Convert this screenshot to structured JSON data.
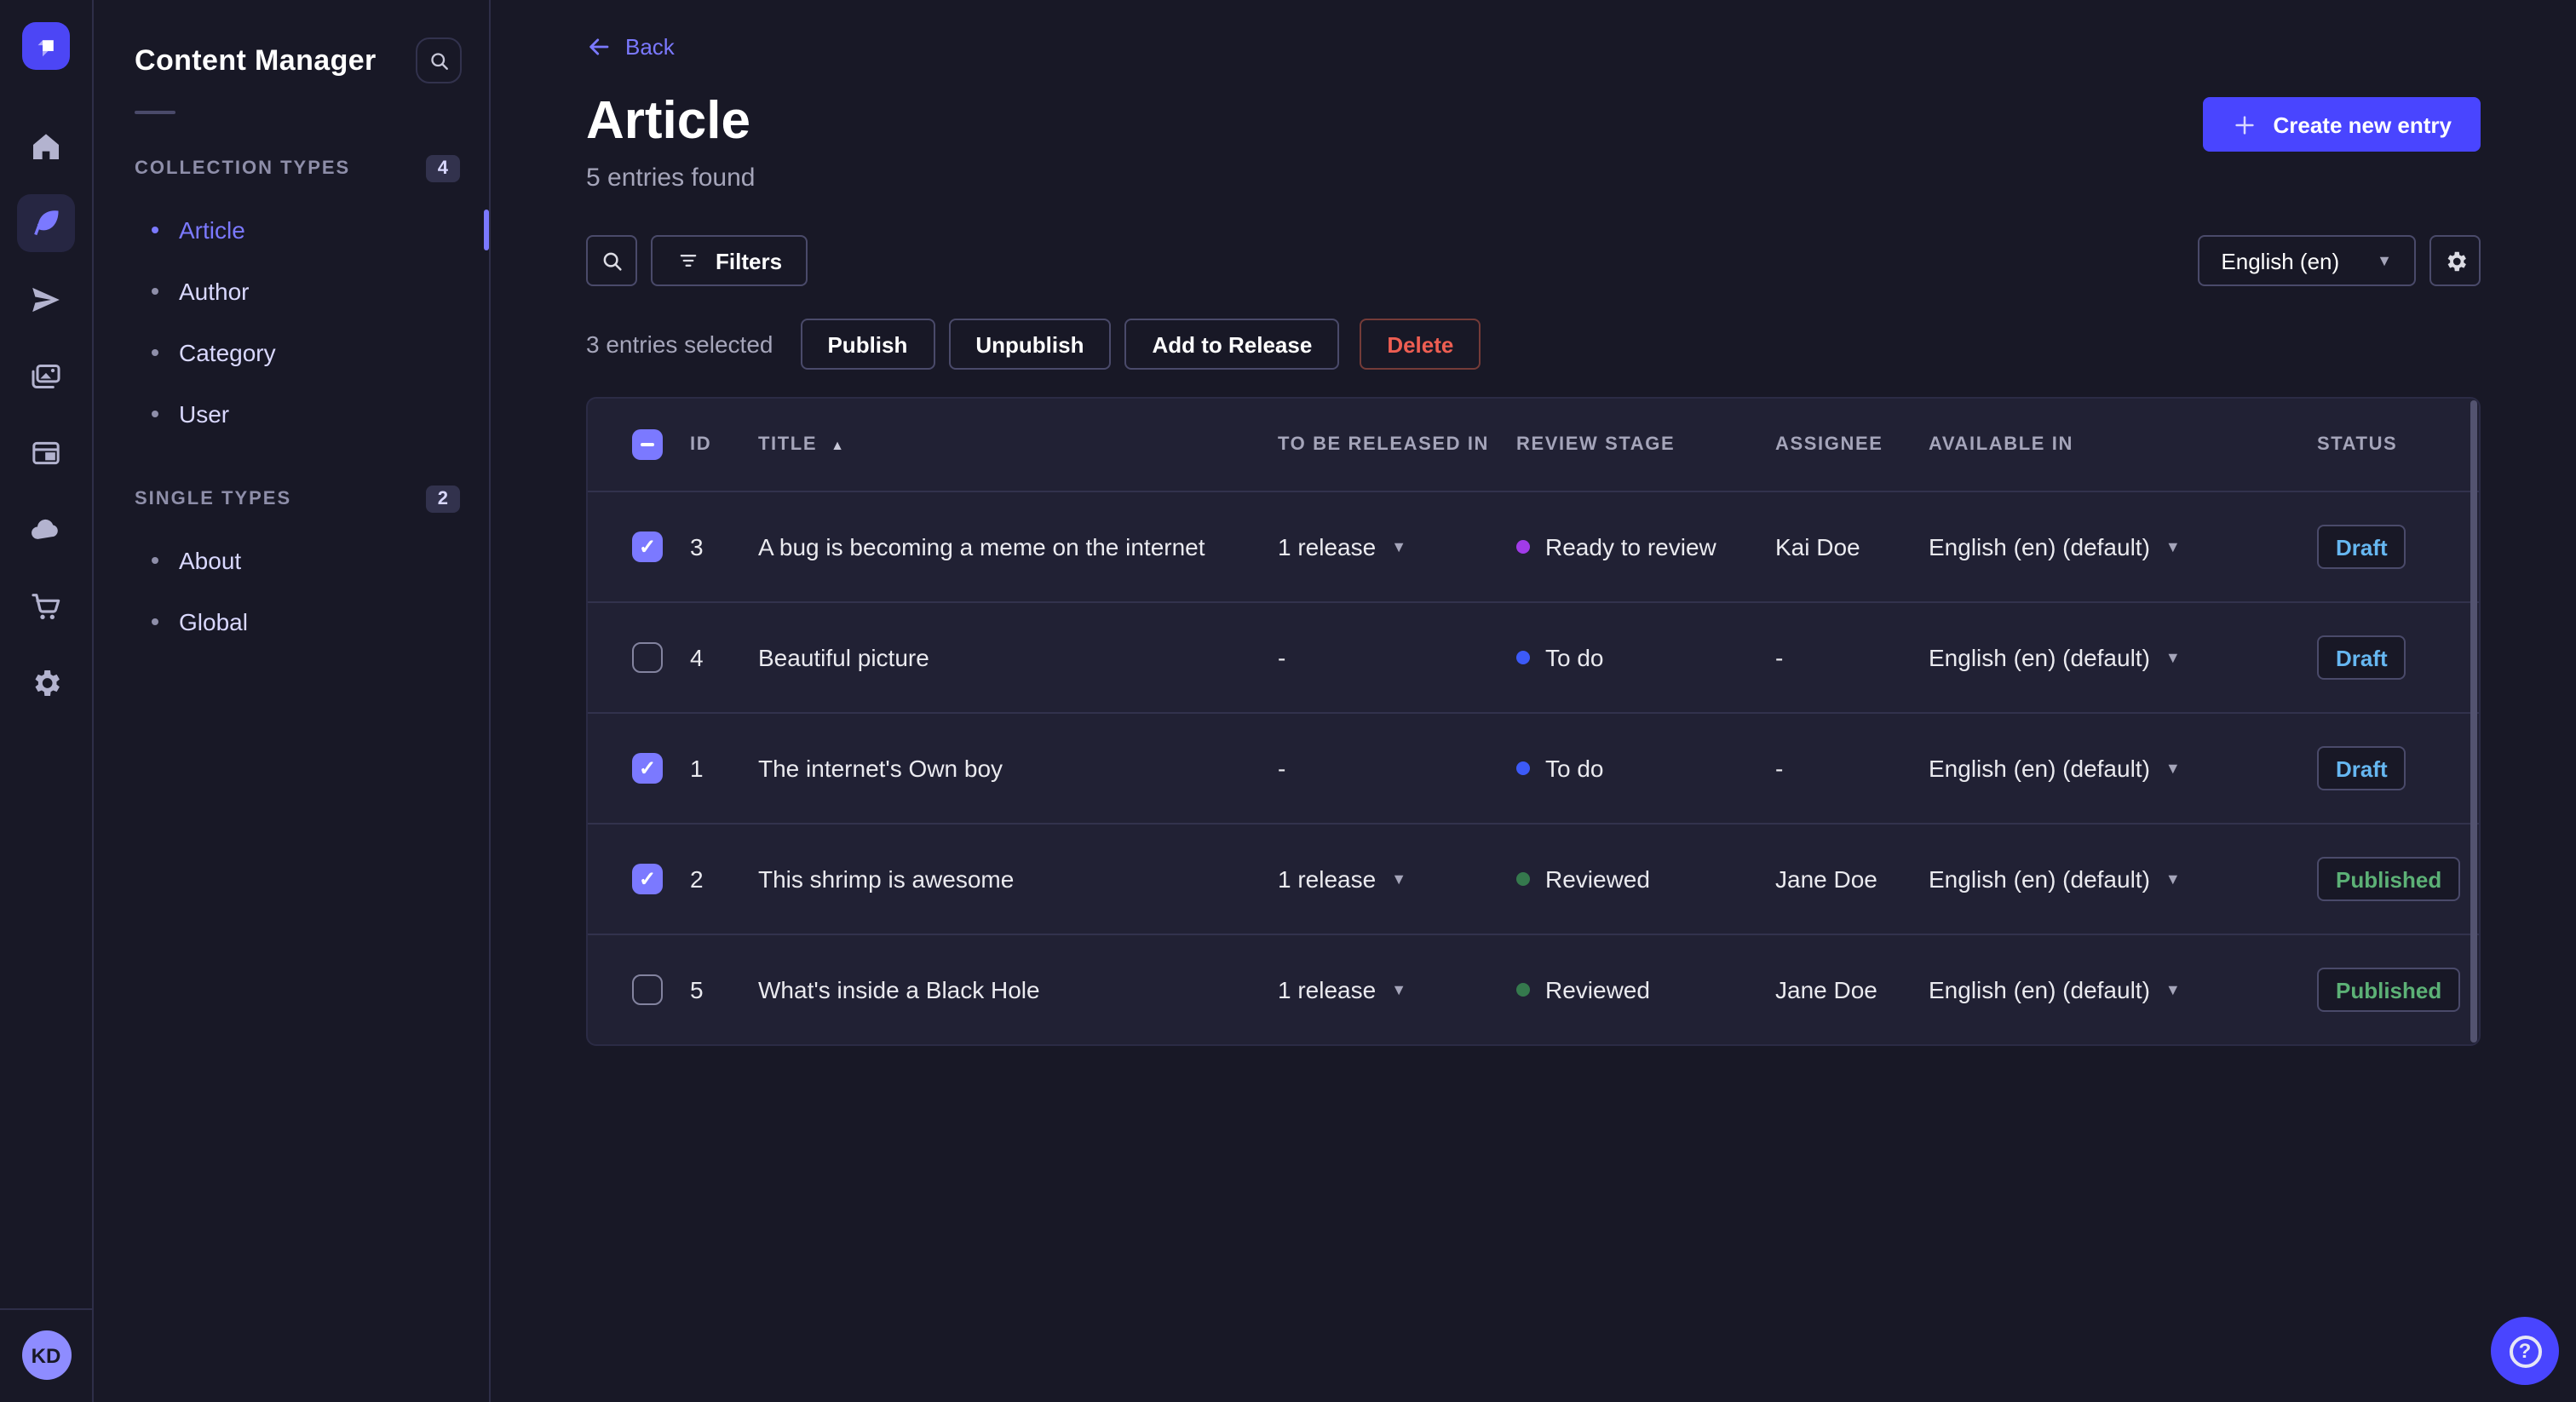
{
  "colors": {
    "accent": "#4945ff",
    "link": "#7b79ff",
    "success": "#5cb176",
    "danger": "#ee5e52",
    "draft": "#66b7f1"
  },
  "rail": {
    "logo_icon": "strapi-logo-icon",
    "icons": [
      "home-icon",
      "content-manager-icon",
      "releases-icon",
      "media-library-icon",
      "content-type-builder-icon",
      "cloud-icon",
      "marketplace-icon",
      "settings-icon"
    ],
    "avatar_initials": "KD"
  },
  "sidebar": {
    "title": "Content Manager",
    "search_icon": "search-icon",
    "sections": [
      {
        "label": "COLLECTION TYPES",
        "badge": "4",
        "items": [
          {
            "label": "Article",
            "active": true
          },
          {
            "label": "Author"
          },
          {
            "label": "Category"
          },
          {
            "label": "User"
          }
        ]
      },
      {
        "label": "SINGLE TYPES",
        "badge": "2",
        "items": [
          {
            "label": "About"
          },
          {
            "label": "Global"
          }
        ]
      }
    ]
  },
  "header": {
    "back_label": "Back",
    "title": "Article",
    "subtitle": "5 entries found",
    "create_label": "Create new entry"
  },
  "toolbar": {
    "filters_label": "Filters",
    "locale_value": "English (en)"
  },
  "selection": {
    "summary": "3 entries selected",
    "actions": [
      {
        "label": "Publish",
        "name": "publish-button"
      },
      {
        "label": "Unpublish",
        "name": "unpublish-button"
      },
      {
        "label": "Add to Release",
        "name": "add-to-release-button"
      },
      {
        "label": "Delete",
        "name": "delete-button",
        "danger": true
      }
    ]
  },
  "table": {
    "columns": [
      "ID",
      "TITLE",
      "TO BE RELEASED IN",
      "REVIEW STAGE",
      "ASSIGNEE",
      "AVAILABLE IN",
      "STATUS"
    ],
    "rows": [
      {
        "checked": true,
        "id": 3,
        "title": "A bug is becoming a meme on the internet",
        "release": "1 release",
        "release_caret": true,
        "stage": "Ready to review",
        "stage_color": "#a13be8",
        "assignee": "Kai Doe",
        "locale": "English (en) (default)",
        "status": "Draft"
      },
      {
        "checked": false,
        "id": 4,
        "title": "Beautiful picture",
        "release": "-",
        "release_caret": false,
        "stage": "To do",
        "stage_color": "#3c5af8",
        "assignee": "-",
        "locale": "English (en) (default)",
        "status": "Draft"
      },
      {
        "checked": true,
        "id": 1,
        "title": "The internet's Own boy",
        "release": "-",
        "release_caret": false,
        "stage": "To do",
        "stage_color": "#3c5af8",
        "assignee": "-",
        "locale": "English (en) (default)",
        "status": "Draft"
      },
      {
        "checked": true,
        "id": 2,
        "title": "This shrimp is awesome",
        "release": "1 release",
        "release_caret": true,
        "stage": "Reviewed",
        "stage_color": "#35794d",
        "assignee": "Jane Doe",
        "locale": "English (en) (default)",
        "status": "Published"
      },
      {
        "checked": false,
        "id": 5,
        "title": "What's inside a Black Hole",
        "release": "1 release",
        "release_caret": true,
        "stage": "Reviewed",
        "stage_color": "#35794d",
        "assignee": "Jane Doe",
        "locale": "English (en) (default)",
        "status": "Published"
      }
    ]
  },
  "help": {
    "icon": "question-icon"
  }
}
